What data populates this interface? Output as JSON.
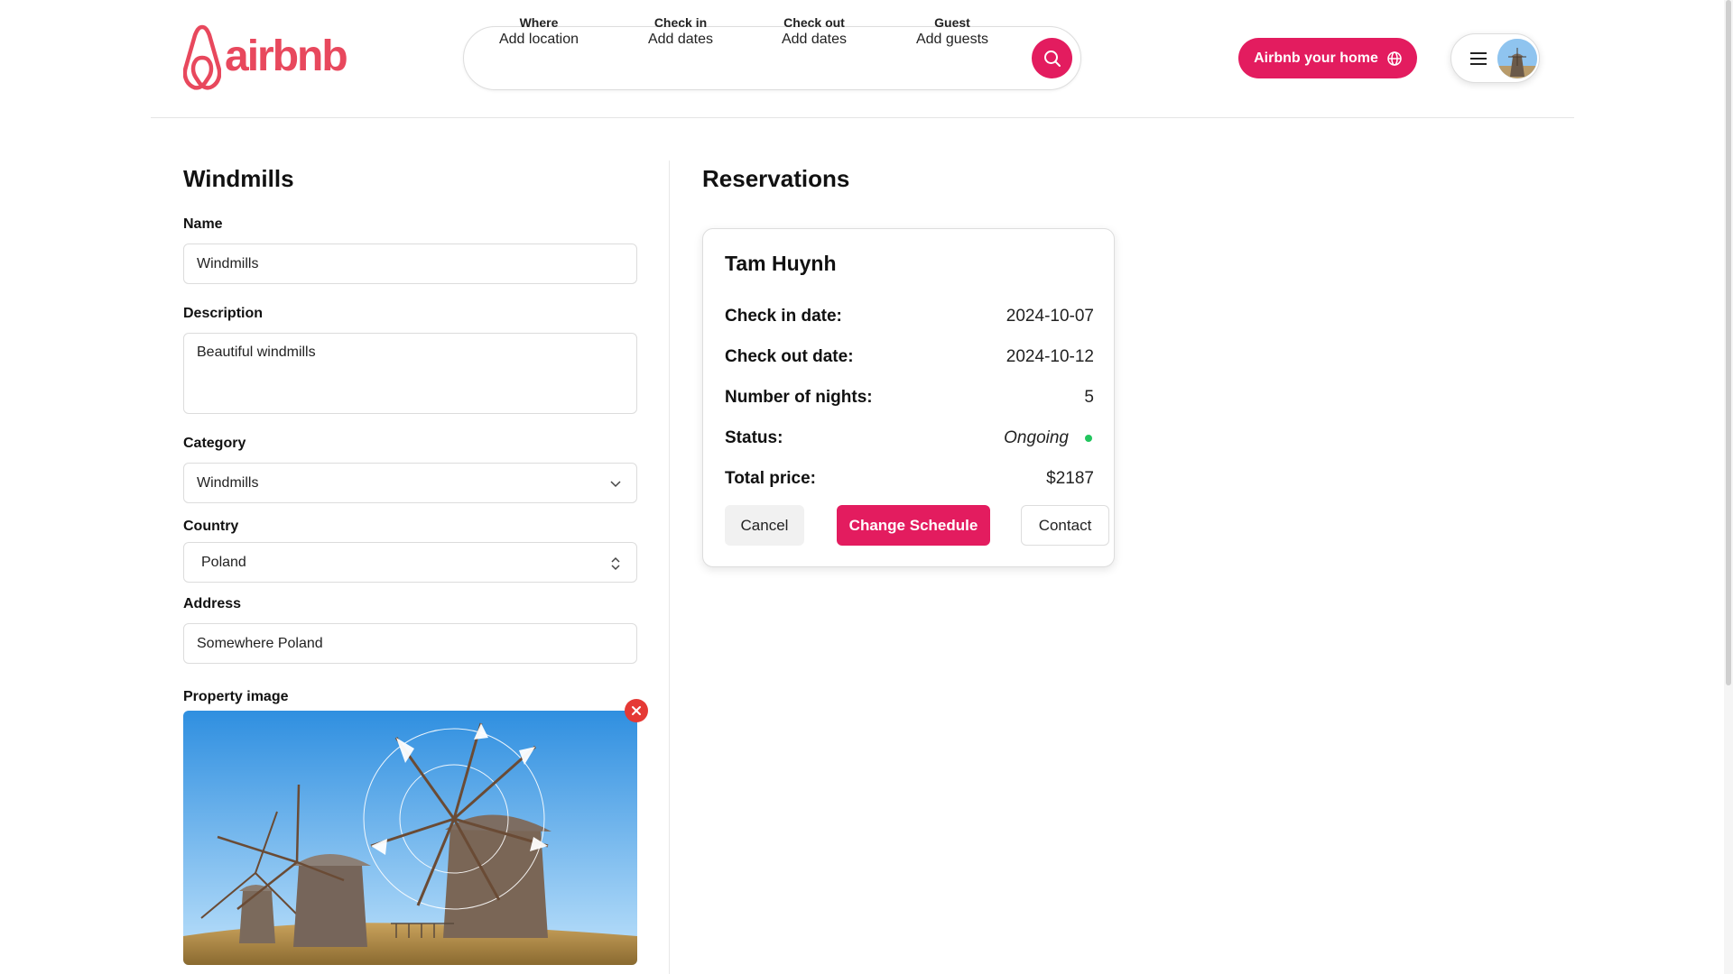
{
  "brand": {
    "name": "airbnb",
    "color": "#e8485d"
  },
  "search": {
    "where": {
      "title": "Where",
      "value": "Add location"
    },
    "check_in": {
      "title": "Check in",
      "value": "Add dates"
    },
    "check_out": {
      "title": "Check out",
      "value": "Add dates"
    },
    "guest": {
      "title": "Guest",
      "value": "Add guests"
    },
    "button_icon": "search-icon",
    "accent": "#e31c5f"
  },
  "header": {
    "host_label": "Airbnb your home",
    "host_icon": "globe-icon",
    "menu_icon": "hamburger-icon",
    "avatar_icon": "user-avatar"
  },
  "property": {
    "section_title": "Windmills",
    "name_label": "Name",
    "name_value": "Windmills",
    "description_label": "Description",
    "description_value": "Beautiful windmills",
    "category_label": "Category",
    "category_value": "Windmills",
    "country_label": "Country",
    "country_value": "Poland",
    "address_label": "Address",
    "address_value": "Somewhere Poland",
    "image_label": "Property image",
    "remove_icon": "close-icon"
  },
  "reservations": {
    "section_title": "Reservations",
    "items": [
      {
        "guest": "Tam Huynh",
        "check_in_label": "Check in date:",
        "check_in": "2024-10-07",
        "check_out_label": "Check out date:",
        "check_out": "2024-10-12",
        "nights_label": "Number of nights:",
        "nights": "5",
        "status_label": "Status:",
        "status": "Ongoing",
        "status_color": "#22c55e",
        "total_label": "Total price:",
        "total": "$2187",
        "actions": {
          "cancel": "Cancel",
          "change": "Change Schedule",
          "contact": "Contact"
        }
      }
    ]
  }
}
